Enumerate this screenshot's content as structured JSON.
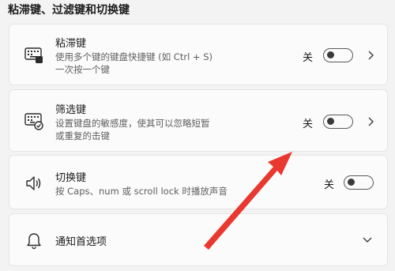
{
  "section_title": "粘滞键、过滤键和切换键",
  "sticky": {
    "title": "粘滞键",
    "desc_line1": "使用多个键的键盘快捷键 (如 Ctrl + S)",
    "desc_line2": "一次按一个键",
    "state": "关",
    "icon": "sticky-keys-keyboard-icon"
  },
  "filter": {
    "title": "筛选键",
    "desc_line1": "设置键盘的敏感度，使其可以忽略短暂",
    "desc_line2": "或重复的击键",
    "state": "关",
    "icon": "filter-keys-keyboard-icon"
  },
  "toggle_keys": {
    "title": "切换键",
    "desc": "按 Caps、num 或 scroll lock 时播放声音",
    "state": "关",
    "icon": "speaker-icon"
  },
  "notify": {
    "title": "通知首选项",
    "icon": "bell-icon"
  },
  "colors": {
    "annotation_arrow": "#e8382f"
  }
}
